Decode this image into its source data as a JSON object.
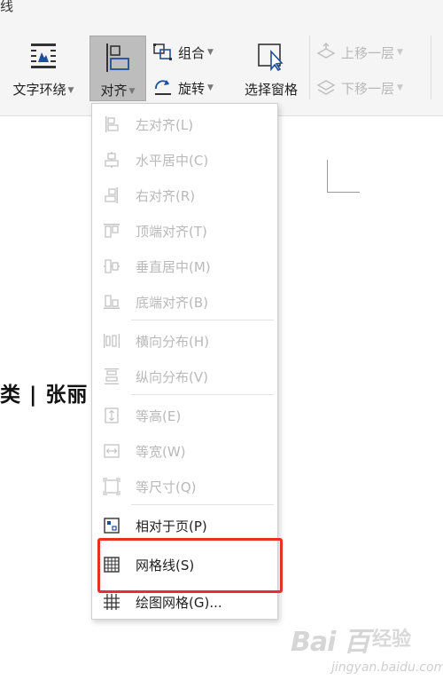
{
  "ribbon": {
    "tab_fragment": "线",
    "text_wrap": {
      "label": "文字环绕"
    },
    "align": {
      "label": "对齐"
    },
    "group": {
      "label": "组合"
    },
    "rotate": {
      "label": "旋转"
    },
    "selection_pane": {
      "label": "选择窗格"
    },
    "bring_forward": {
      "label": "上移一层"
    },
    "send_backward": {
      "label": "下移一层"
    }
  },
  "document": {
    "visible_text": "类 | 张丽"
  },
  "align_menu": {
    "items": [
      {
        "label": "左对齐(L)",
        "enabled": false
      },
      {
        "label": "水平居中(C)",
        "enabled": false
      },
      {
        "label": "右对齐(R)",
        "enabled": false
      },
      {
        "label": "顶端对齐(T)",
        "enabled": false
      },
      {
        "label": "垂直居中(M)",
        "enabled": false
      },
      {
        "label": "底端对齐(B)",
        "enabled": false
      },
      {
        "label": "横向分布(H)",
        "enabled": false
      },
      {
        "label": "纵向分布(V)",
        "enabled": false
      },
      {
        "label": "等高(E)",
        "enabled": false
      },
      {
        "label": "等宽(W)",
        "enabled": false
      },
      {
        "label": "等尺寸(Q)",
        "enabled": false
      },
      {
        "label": "相对于页(P)",
        "enabled": true
      },
      {
        "label": "网格线(S)",
        "enabled": true,
        "highlighted": true
      },
      {
        "label": "绘图网格(G)...",
        "enabled": true
      }
    ]
  },
  "watermark": {
    "logo": "Bai  百",
    "name": "经验",
    "url": "jingyan.baidu.com"
  },
  "colors": {
    "highlight_border": "#e8302b",
    "active_button_bg": "#bdbdbd",
    "disabled_text": "#b9b9b9"
  }
}
